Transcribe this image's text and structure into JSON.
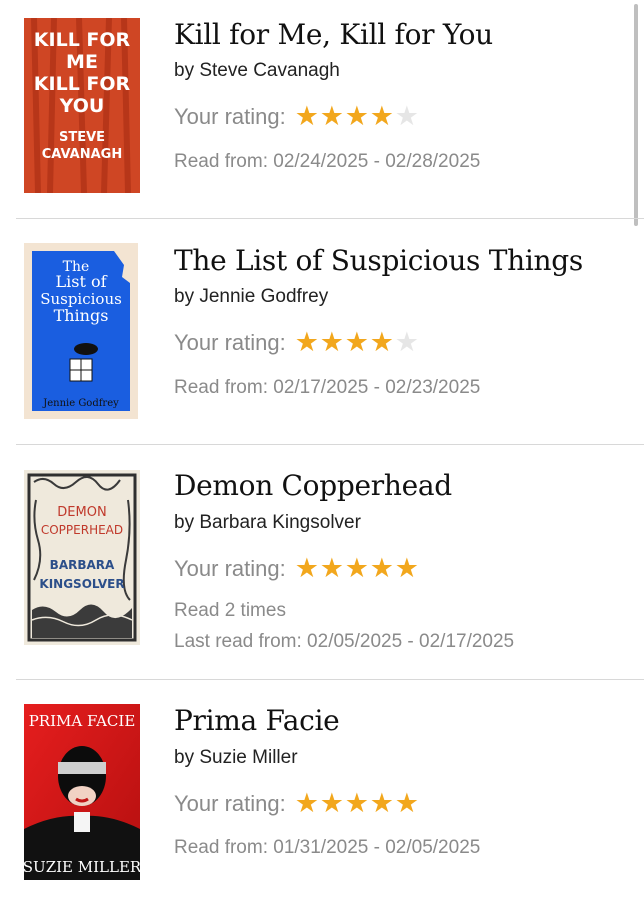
{
  "books": [
    {
      "title": "Kill for Me, Kill for You",
      "author": "by Steve Cavanagh",
      "rating_label": "Your rating:",
      "rating": 4,
      "read_from": "Read from: 02/24/2025 - 02/28/2025",
      "cover": {
        "lines": [
          "KILL FOR",
          "ME",
          "KILL FOR",
          "YOU",
          "STEVE",
          "CAVANAGH"
        ],
        "bg": "#c8401f"
      }
    },
    {
      "title": "The List of Suspicious Things",
      "author": "by Jennie Godfrey",
      "rating_label": "Your rating:",
      "rating": 4,
      "read_from": "Read from: 02/17/2025 - 02/23/2025",
      "cover": {
        "lines": [
          "The",
          "List of",
          "Suspicious",
          "Things",
          "Jennie Godfrey"
        ],
        "bg": "#1a5ee0"
      }
    },
    {
      "title": "Demon Copperhead",
      "author": "by Barbara Kingsolver",
      "rating_label": "Your rating:",
      "rating": 5,
      "read_count": "Read 2 times",
      "read_from": "Last read from: 02/05/2025 - 02/17/2025",
      "cover": {
        "lines": [
          "DEMON",
          "COPPERHEAD",
          "BARBARA",
          "KINGSOLVER"
        ],
        "bg": "#efe9dc"
      }
    },
    {
      "title": "Prima Facie",
      "author": "by Suzie Miller",
      "rating_label": "Your rating:",
      "rating": 5,
      "read_from": "Read from: 01/31/2025 - 02/05/2025",
      "cover": {
        "lines": [
          "PRIMA FACIE",
          "SUZIE MILLER"
        ],
        "bg": "#e02020"
      }
    }
  ],
  "colors": {
    "star": "#f2a71d",
    "star_empty": "#e6e6e6",
    "meta_text": "#8a8a8a"
  }
}
